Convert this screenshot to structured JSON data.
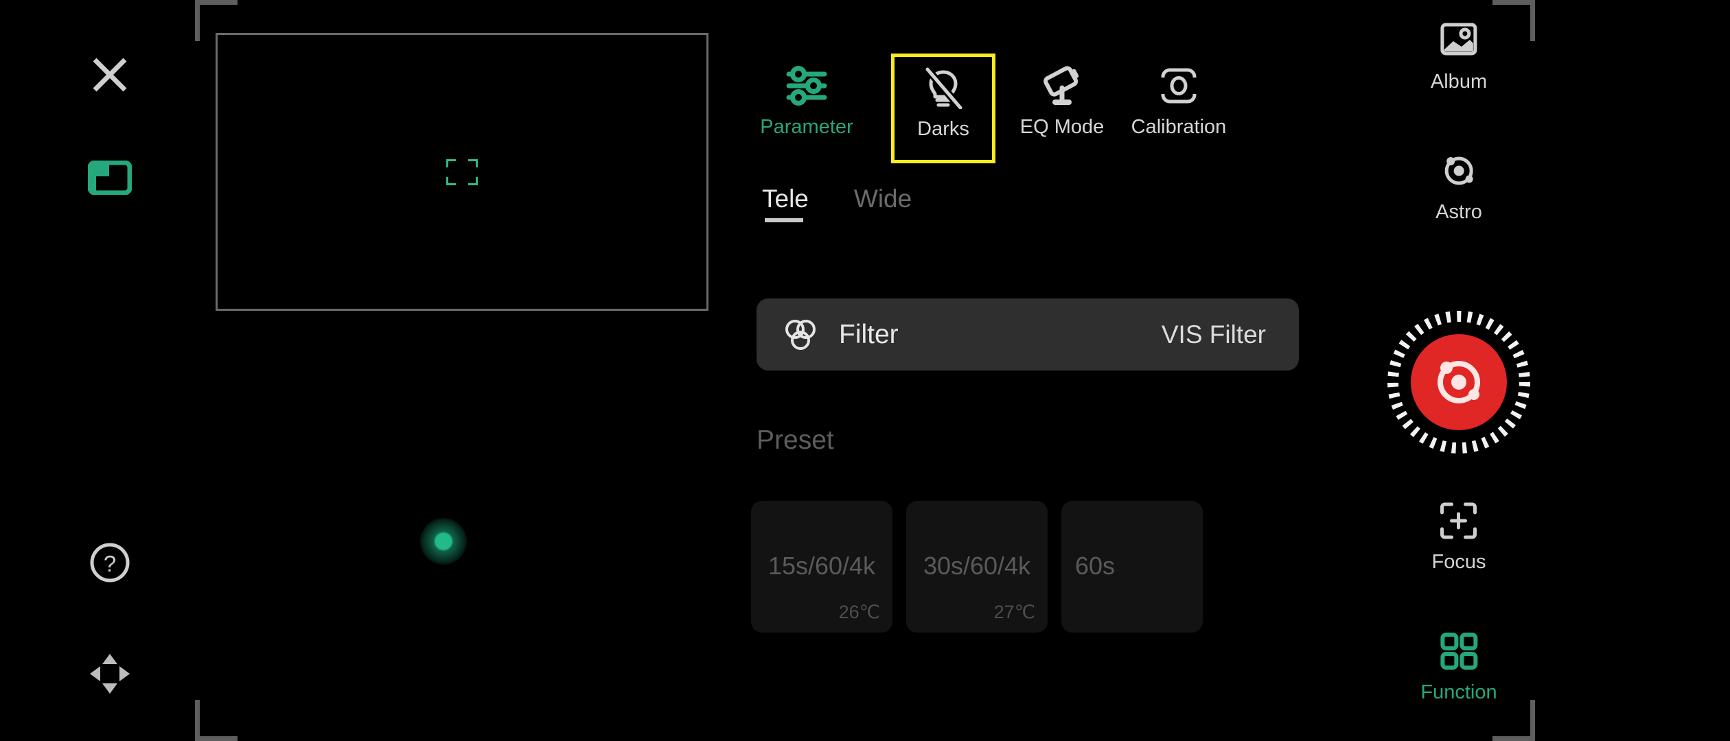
{
  "app": {
    "theme": {
      "background": "#000000",
      "accent_green": "#25a87d",
      "highlight_yellow": "#fbec1c",
      "record_red": "#e12626"
    }
  },
  "left_rail": {
    "close_icon": "close-x-icon",
    "pip_icon": "picture-in-picture-icon",
    "help_icon": "help-question-icon",
    "dpad_icon": "directional-pad-icon"
  },
  "preview": {
    "reticle_icon": "focus-reticle-icon",
    "star_marker_icon": "star-marker-dot"
  },
  "modebar": {
    "items": [
      {
        "label": "Parameter",
        "icon": "sliders-icon",
        "state": "active-green"
      },
      {
        "label": "Darks",
        "icon": "lightbulb-off-icon",
        "state": "selected"
      },
      {
        "label": "EQ Mode",
        "icon": "telescope-icon",
        "state": "normal"
      },
      {
        "label": "Calibration",
        "icon": "frame-circle-icon",
        "state": "normal"
      }
    ]
  },
  "camera_tabs": [
    {
      "label": "Tele",
      "active": true
    },
    {
      "label": "Wide",
      "active": false
    }
  ],
  "filter_row": {
    "icon": "venn-circles-icon",
    "label": "Filter",
    "value": "VIS Filter"
  },
  "preset_section": {
    "title": "Preset",
    "items": [
      {
        "name": "15s/60/4k",
        "temperature": "26℃"
      },
      {
        "name": "30s/60/4k",
        "temperature": "27℃"
      },
      {
        "name": "60s",
        "temperature": ""
      }
    ]
  },
  "right_rail": {
    "album": {
      "label": "Album",
      "icon": "image-photo-icon"
    },
    "astro": {
      "label": "Astro",
      "icon": "atom-orbit-icon"
    },
    "focus": {
      "label": "Focus",
      "icon": "focus-crosshair-icon"
    },
    "function": {
      "label": "Function",
      "icon": "grid-squares-icon"
    },
    "shutter": {
      "icon": "record-shutter-astro-icon"
    }
  }
}
